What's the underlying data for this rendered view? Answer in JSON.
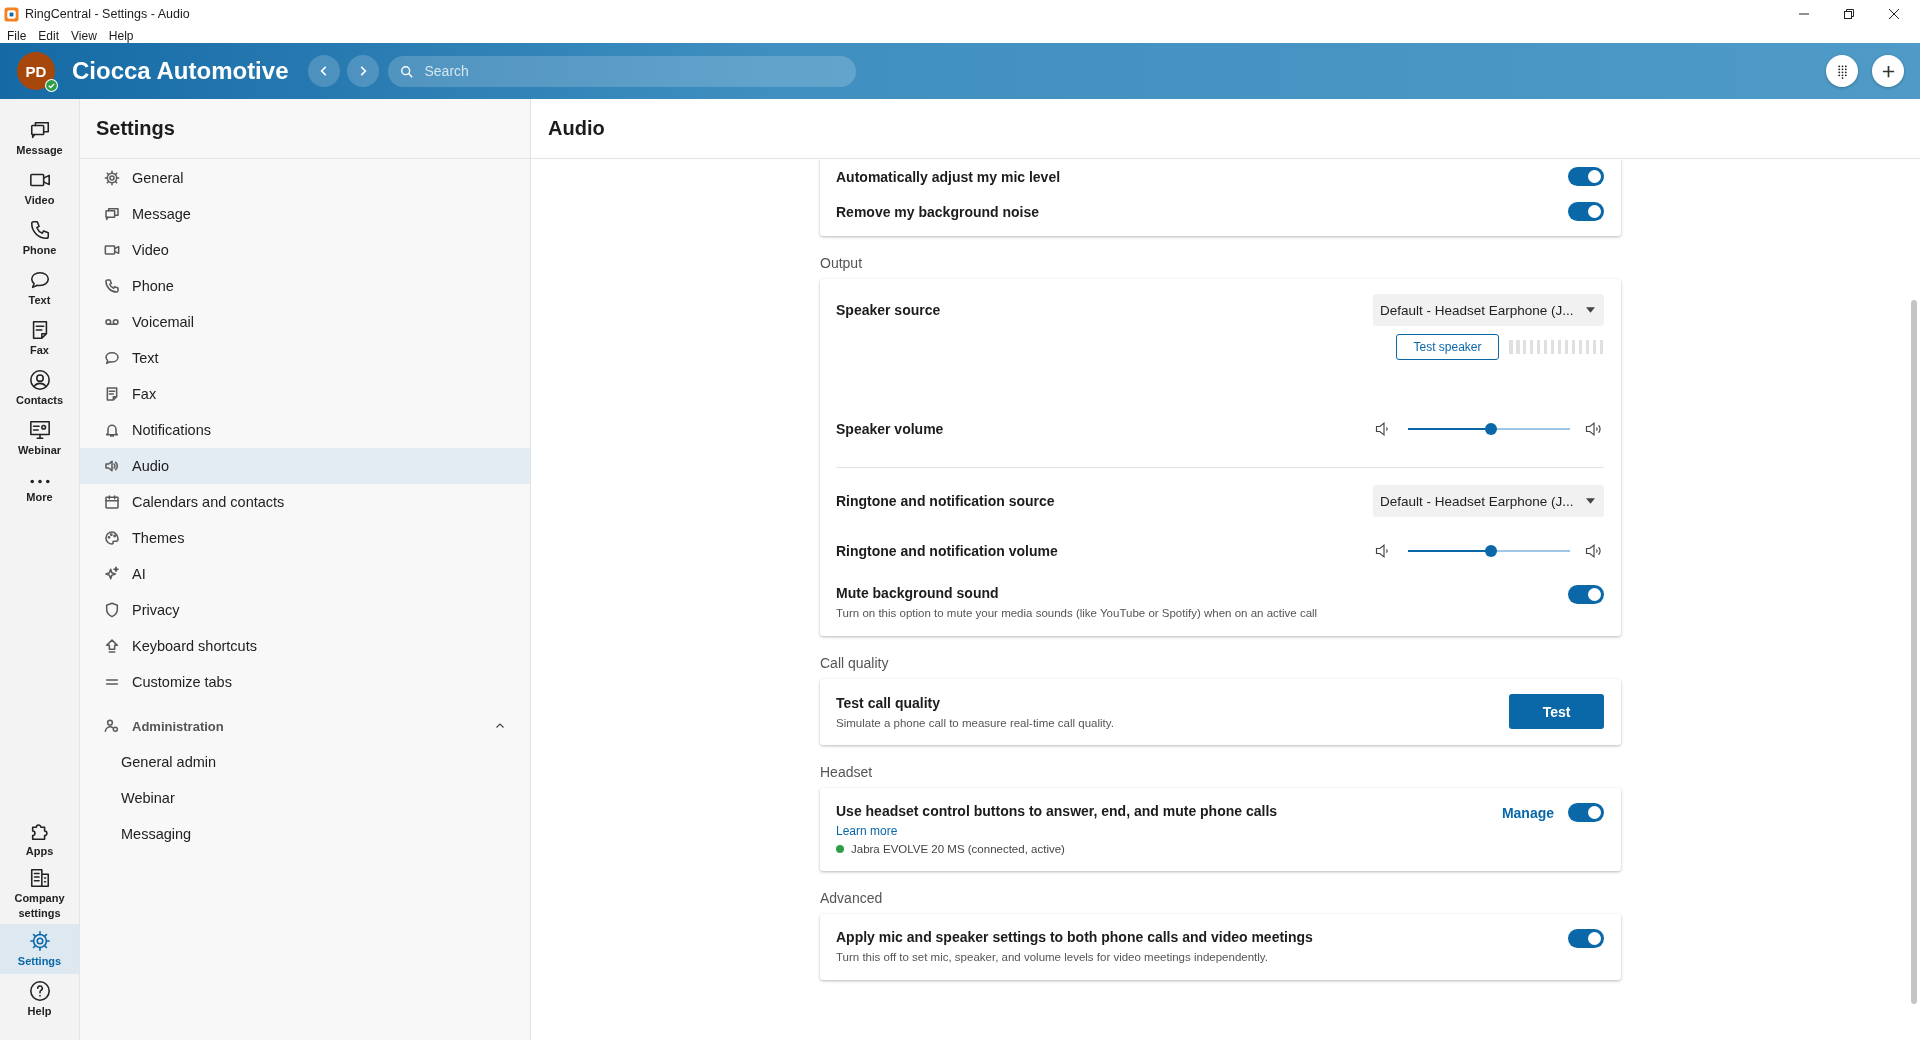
{
  "window": {
    "title": "RingCentral - Settings - Audio"
  },
  "menu_bar": [
    "File",
    "Edit",
    "View",
    "Help"
  ],
  "header": {
    "avatar_initials": "PD",
    "title": "Ciocca Automotive",
    "search": {
      "placeholder": "Search"
    }
  },
  "rail": {
    "top": [
      {
        "label": "Message",
        "selected": false
      },
      {
        "label": "Video",
        "selected": false
      },
      {
        "label": "Phone",
        "selected": false
      },
      {
        "label": "Text",
        "selected": false
      },
      {
        "label": "Fax",
        "selected": false
      },
      {
        "label": "Contacts",
        "selected": false
      },
      {
        "label": "Webinar",
        "selected": false
      },
      {
        "label": "More",
        "selected": false
      }
    ],
    "bottom": [
      {
        "label": "Apps",
        "selected": false
      },
      {
        "label": "Company settings",
        "selected": false
      },
      {
        "label": "Settings",
        "selected": true
      },
      {
        "label": "Help",
        "selected": false
      }
    ]
  },
  "settings_nav": {
    "title": "Settings",
    "items": [
      {
        "label": "General",
        "selected": false
      },
      {
        "label": "Message",
        "selected": false
      },
      {
        "label": "Video",
        "selected": false
      },
      {
        "label": "Phone",
        "selected": false
      },
      {
        "label": "Voicemail",
        "selected": false
      },
      {
        "label": "Text",
        "selected": false
      },
      {
        "label": "Fax",
        "selected": false
      },
      {
        "label": "Notifications",
        "selected": false
      },
      {
        "label": "Audio",
        "selected": true
      },
      {
        "label": "Calendars and contacts",
        "selected": false
      },
      {
        "label": "Themes",
        "selected": false
      },
      {
        "label": "AI",
        "selected": false
      },
      {
        "label": "Privacy",
        "selected": false
      },
      {
        "label": "Keyboard shortcuts",
        "selected": false
      },
      {
        "label": "Customize tabs",
        "selected": false
      }
    ],
    "administration": {
      "label": "Administration",
      "expanded": true,
      "children": [
        {
          "label": "General admin",
          "selected": false
        },
        {
          "label": "Webinar",
          "selected": false
        },
        {
          "label": "Messaging",
          "selected": false
        }
      ]
    }
  },
  "page": {
    "title": "Audio",
    "sections": [
      {
        "rows": [
          {
            "kind": "toggle",
            "label": "Automatically adjust my mic level",
            "on": true
          },
          {
            "kind": "toggle",
            "label": "Remove my background noise",
            "on": true
          }
        ]
      },
      {
        "heading": "Output",
        "rows": [
          {
            "kind": "dropdown",
            "label": "Speaker source",
            "value": "Default - Headset Earphone (J...",
            "test_button": "Test speaker",
            "meter": {
              "level": 0
            }
          },
          {
            "kind": "slider",
            "label": "Speaker volume",
            "level": 0.51
          },
          {
            "kind": "divider"
          },
          {
            "kind": "dropdown",
            "label": "Ringtone and notification source",
            "value": "Default - Headset Earphone (J..."
          },
          {
            "kind": "slider",
            "label": "Ringtone and notification volume",
            "level": 0.51
          },
          {
            "kind": "toggle",
            "label": "Mute background sound",
            "description": "Turn on this option to mute your media sounds (like YouTube or Spotify) when on an active call",
            "on": true
          }
        ]
      },
      {
        "heading": "Call quality",
        "rows": [
          {
            "kind": "button",
            "label": "Test call quality",
            "description": "Simulate a phone call to measure real-time call quality.",
            "button": "Test"
          }
        ]
      },
      {
        "heading": "Headset",
        "rows": [
          {
            "kind": "headset",
            "label": "Use headset control buttons to answer, end, and mute phone calls",
            "link": "Learn more",
            "device": "Jabra EVOLVE 20 MS (connected, active)",
            "action": "Manage",
            "on": true
          }
        ]
      },
      {
        "heading": "Advanced",
        "rows": [
          {
            "kind": "toggle",
            "label": "Apply mic and speaker settings to both phone calls and video meetings",
            "description": "Turn this off to set mic, speaker, and volume levels for video meetings independently.",
            "on": true
          }
        ]
      }
    ]
  }
}
